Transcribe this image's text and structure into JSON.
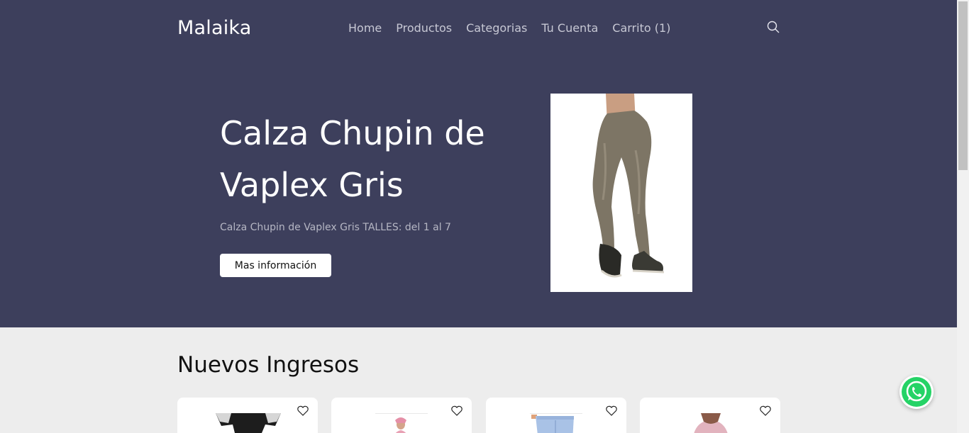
{
  "header": {
    "brand": "Malaika",
    "nav": [
      "Home",
      "Productos",
      "Categorias",
      "Tu Cuenta",
      "Carrito (1)"
    ]
  },
  "hero": {
    "title": "Calza Chupin de Vaplex Gris",
    "description": "Calza Chupin de Vaplex Gris TALLES: del 1 al 7",
    "button": "Mas información"
  },
  "section": {
    "title": "Nuevos Ingresos"
  },
  "products": [
    {
      "icon": "heart-icon"
    },
    {
      "icon": "heart-icon"
    },
    {
      "icon": "heart-icon"
    },
    {
      "icon": "heart-icon"
    }
  ],
  "colors": {
    "hero_bg": "#3d3f5c",
    "page_bg": "#ededed",
    "whatsapp": "#25d366"
  }
}
